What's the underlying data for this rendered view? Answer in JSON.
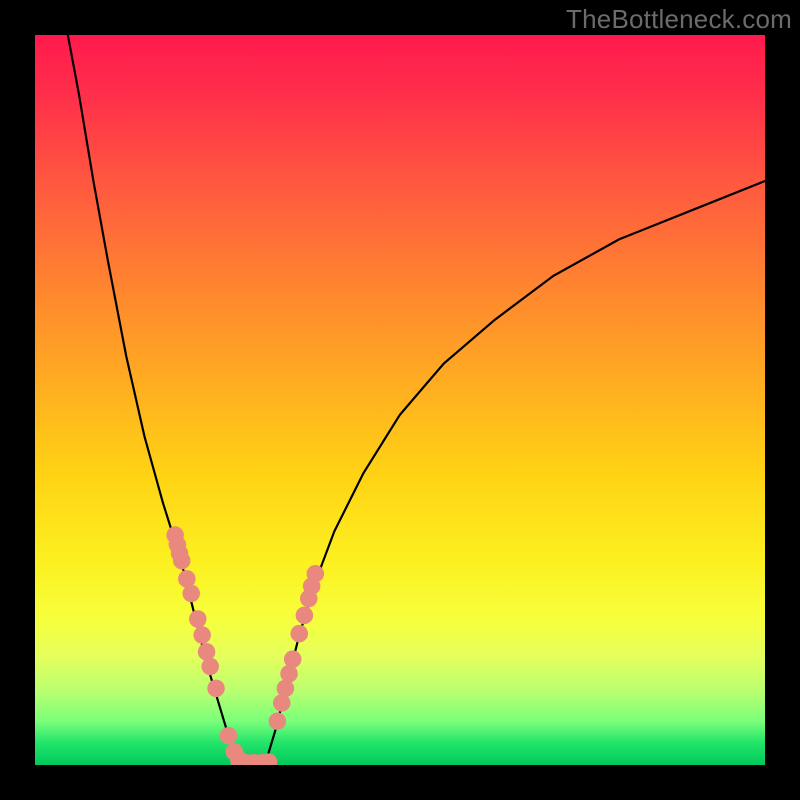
{
  "watermark": "TheBottleneck.com",
  "chart_data": {
    "type": "line",
    "title": "",
    "xlabel": "",
    "ylabel": "",
    "xlim": [
      0,
      100
    ],
    "ylim": [
      0,
      100
    ],
    "grid": false,
    "legend": false,
    "background_gradient": [
      {
        "pos": 0.0,
        "color": "#ff1a4d"
      },
      {
        "pos": 0.5,
        "color": "#ffc814"
      },
      {
        "pos": 0.8,
        "color": "#f6ff3c"
      },
      {
        "pos": 1.0,
        "color": "#00c95c"
      }
    ],
    "series": [
      {
        "name": "curve-left",
        "stroke": "#000000",
        "x": [
          4.5,
          6,
          8,
          10,
          12.5,
          15,
          17.5,
          20,
          22,
          23.5,
          25,
          26.5,
          28
        ],
        "y": [
          100,
          92,
          80,
          69,
          56,
          45,
          36,
          28,
          20,
          14,
          9,
          4,
          0
        ]
      },
      {
        "name": "curve-right",
        "stroke": "#000000",
        "x": [
          31.5,
          33,
          34.5,
          36,
          38,
          41,
          45,
          50,
          56,
          63,
          71,
          80,
          90,
          100
        ],
        "y": [
          0,
          5,
          11,
          17,
          24,
          32,
          40,
          48,
          55,
          61,
          67,
          72,
          76,
          80
        ]
      }
    ],
    "scatter": [
      {
        "name": "dots-left",
        "fill": "#e9887f",
        "r": 1.2,
        "x": [
          19.2,
          19.5,
          19.8,
          20.1,
          20.8,
          21.4,
          22.3,
          22.9,
          23.5,
          24.0,
          24.8,
          26.5,
          27.3,
          27.9
        ],
        "y": [
          31.5,
          30.2,
          29.0,
          28.0,
          25.5,
          23.5,
          20.0,
          17.8,
          15.5,
          13.5,
          10.5,
          4.0,
          1.8,
          0.8
        ]
      },
      {
        "name": "dots-bottom",
        "fill": "#e9887f",
        "r": 1.2,
        "x": [
          28.0,
          29.0,
          30.0,
          31.0,
          32.0
        ],
        "y": [
          0.4,
          0.3,
          0.3,
          0.3,
          0.4
        ]
      },
      {
        "name": "dots-right",
        "fill": "#e9887f",
        "r": 1.2,
        "x": [
          33.2,
          33.8,
          34.3,
          34.8,
          35.3,
          36.2,
          36.9,
          37.5,
          37.9,
          38.4
        ],
        "y": [
          6.0,
          8.5,
          10.5,
          12.5,
          14.5,
          18.0,
          20.5,
          22.8,
          24.5,
          26.2
        ]
      }
    ]
  }
}
